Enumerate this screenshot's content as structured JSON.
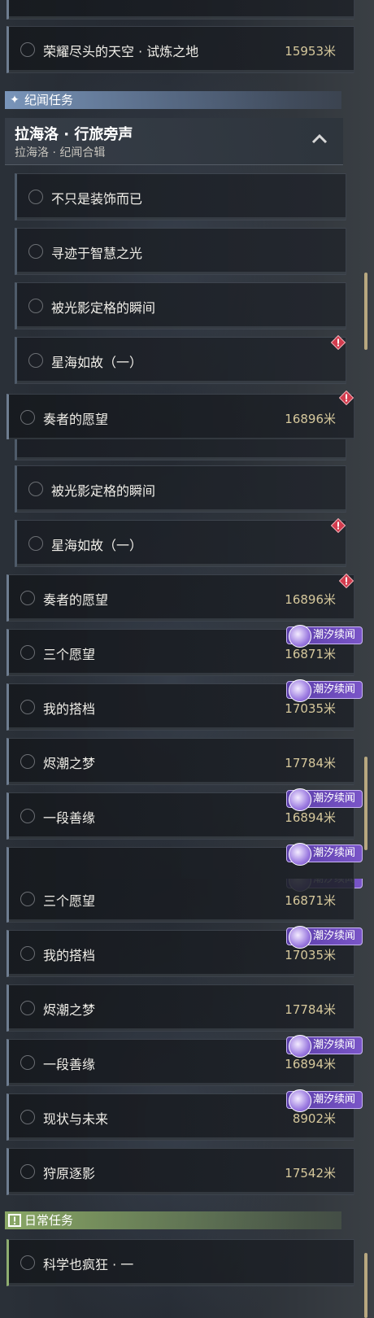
{
  "sections": {
    "jiwen": "纪闻任务",
    "daily": "日常任务"
  },
  "group": {
    "title": "拉海洛 · 行旅旁声",
    "subtitle": "拉海洛 · 纪闻合辑"
  },
  "badge_label": "潮汐续闻",
  "unit": "米",
  "quests": {
    "trial": {
      "title": "荣耀尽头的天空 · 试炼之地",
      "distance": "15953米"
    },
    "decor": {
      "title": "不只是装饰而已"
    },
    "wisdom": {
      "title": "寻迹于智慧之光"
    },
    "moment": {
      "title": "被光影定格的瞬间"
    },
    "stars": {
      "title": "星海如故（一）"
    },
    "wish": {
      "title": "奏者的愿望",
      "distance": "16896米"
    },
    "three": {
      "title": "三个愿望",
      "distance": "16871米"
    },
    "partner": {
      "title": "我的搭档",
      "distance": "17035米"
    },
    "dream": {
      "title": "烬潮之梦",
      "distance": "17784米"
    },
    "bond": {
      "title": "一段善缘",
      "distance": "16894米"
    },
    "future": {
      "title": "现状与未来",
      "distance": "8902米"
    },
    "shadow": {
      "title": "狩原逐影",
      "distance": "17542米"
    },
    "science": {
      "title": "科学也疯狂 · 一"
    }
  },
  "colors": {
    "accent_gold": "#d6c89c",
    "badge_purple": "#7a55c8",
    "warn_red": "#d23c4e",
    "daily_green": "#8aa866"
  }
}
